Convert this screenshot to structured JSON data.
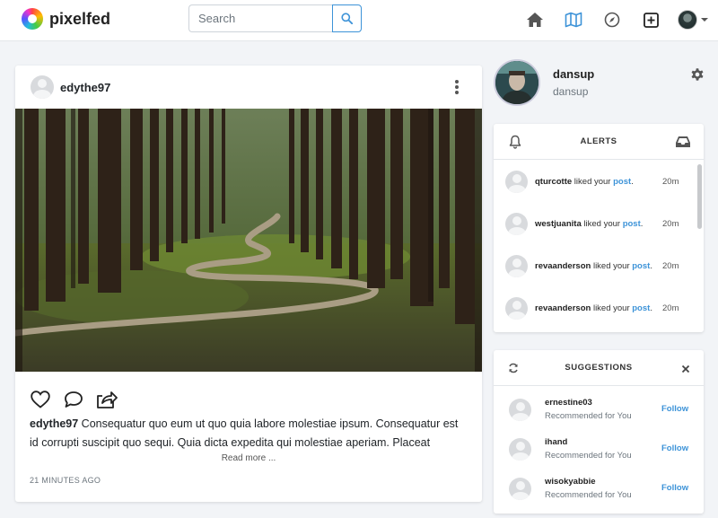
{
  "brand": {
    "name": "pixelfed"
  },
  "search": {
    "placeholder": "Search"
  },
  "nav": {
    "icons": [
      "home-icon",
      "map-icon",
      "compass-icon",
      "plus-square-icon"
    ],
    "caret": "chevron-down-icon"
  },
  "post": {
    "username": "edythe97",
    "caption_user": "edythe97",
    "caption_text": " Consequatur quo eum ut quo quia labore molestiae ipsum. Consequatur est id corrupti suscipit quo sequi. Quia dicta expedita qui molestiae aperiam. Placeat",
    "read_more": "Read more ...",
    "timestamp": "21 MINUTES AGO"
  },
  "profile": {
    "name": "dansup",
    "handle": "dansup"
  },
  "alerts": {
    "title": "ALERTS",
    "items": [
      {
        "user": "qturcotte",
        "text": " liked your ",
        "link": "post",
        "end": ".",
        "time": "20m"
      },
      {
        "user": "westjuanita",
        "text": " liked your ",
        "link": "post",
        "end": ".",
        "time": "20m"
      },
      {
        "user": "revaanderson",
        "text": " liked your ",
        "link": "post",
        "end": ".",
        "time": "20m"
      },
      {
        "user": "revaanderson",
        "text": " liked your ",
        "link": "post",
        "end": ".",
        "time": "20m"
      }
    ]
  },
  "suggestions": {
    "title": "SUGGESTIONS",
    "items": [
      {
        "name": "ernestine03",
        "sub": "Recommended for You",
        "action": "Follow"
      },
      {
        "name": "ihand",
        "sub": "Recommended for You",
        "action": "Follow"
      },
      {
        "name": "wisokyabbie",
        "sub": "Recommended for You",
        "action": "Follow"
      }
    ]
  },
  "colors": {
    "accent": "#3d93d8",
    "background": "#f2f4f7"
  }
}
